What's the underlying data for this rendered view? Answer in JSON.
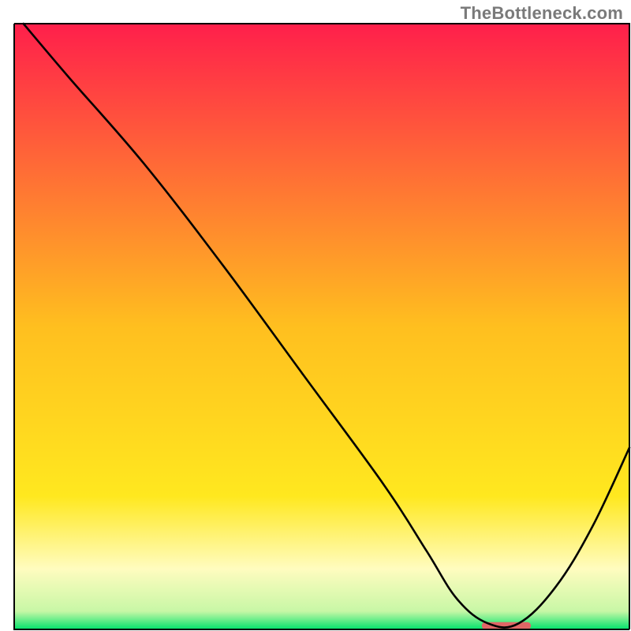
{
  "watermark": {
    "text": "TheBottleneck.com"
  },
  "chart_data": {
    "type": "line",
    "title": "",
    "xlabel": "",
    "ylabel": "",
    "xlim": [
      0,
      100
    ],
    "ylim": [
      0,
      100
    ],
    "grid": false,
    "legend": false,
    "background_gradient": {
      "stops": [
        {
          "offset": 0.0,
          "color": "#ff1f4b"
        },
        {
          "offset": 0.5,
          "color": "#ffbf1f"
        },
        {
          "offset": 0.78,
          "color": "#ffe81f"
        },
        {
          "offset": 0.9,
          "color": "#fffcbf"
        },
        {
          "offset": 0.97,
          "color": "#c8f7a6"
        },
        {
          "offset": 1.0,
          "color": "#00e36b"
        }
      ]
    },
    "series": [
      {
        "name": "bottleneck-curve",
        "color": "#000000",
        "x": [
          1.5,
          9,
          21,
          34,
          47,
          60,
          67,
          72,
          77,
          82,
          88,
          94,
          100
        ],
        "y": [
          100,
          91,
          77,
          60,
          42,
          24,
          13,
          5,
          1,
          1,
          7,
          17,
          30
        ]
      }
    ],
    "marker": {
      "name": "optimal-range",
      "color": "#e06666",
      "x_start": 76,
      "x_end": 84,
      "y": 0,
      "height": 1.2
    },
    "frame": {
      "color": "#000000",
      "width": 2
    }
  }
}
